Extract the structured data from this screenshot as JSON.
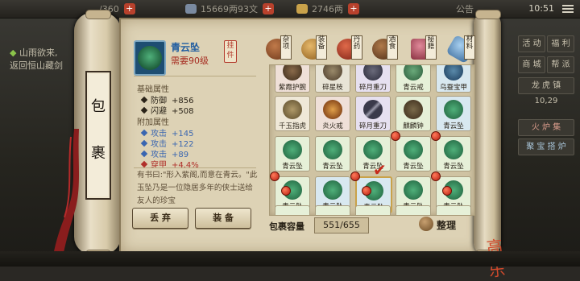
{
  "topbar": {
    "energy": "…/360",
    "silver": "15669两93文",
    "gold": "2746两",
    "notice": "公告",
    "time": "10:51"
  },
  "quest": {
    "line1": "山雨欲来,",
    "line2": "返回恒山藏剑"
  },
  "right_panel": {
    "btn_activity": "活 动",
    "btn_welfare": "福 利",
    "btn_mall": "商 城",
    "btn_gang": "帮 派",
    "btn_dragon": "龙 虎 镇",
    "coord": "10,29",
    "btn_furnace": "火 炉 集",
    "btn_treasure": "聚 宝 搭 炉"
  },
  "bag": {
    "title_1": "包",
    "title_2": "裹"
  },
  "detail": {
    "name": "青云坠",
    "requirement": "需要90级",
    "tag": "挂件",
    "base_title": "基础属性",
    "base_attrs": [
      {
        "label": "防御",
        "value": "+856"
      },
      {
        "label": "闪避",
        "value": "+508"
      }
    ],
    "extra_title": "附加属性",
    "extra_attrs": [
      {
        "label": "攻击",
        "value": "+145",
        "color": "#3a66b0"
      },
      {
        "label": "攻击",
        "value": "+122",
        "color": "#3a66b0"
      },
      {
        "label": "攻击",
        "value": "+89",
        "color": "#3a66b0"
      },
      {
        "label": "穿甲",
        "value": "+4.4%",
        "color": "#b0302a"
      }
    ],
    "description": "有书曰:\"形入紫阁,而意在青云。\"此玉坠乃是一位隐居多年的侠士送给友人的珍宝",
    "btn_discard": "丢 弃",
    "btn_equip": "装 备"
  },
  "categories": [
    {
      "label": "杂项",
      "color": "#8a4a2a"
    },
    {
      "label": "装备",
      "color": "#c98a3a"
    },
    {
      "label": "丹药",
      "color": "#b13a2a"
    },
    {
      "label": "酒食",
      "color": "#7a4a2a"
    },
    {
      "label": "秘籍",
      "color": "#b04050"
    },
    {
      "label": "材料",
      "color": "#5a8ac0"
    }
  ],
  "grid": {
    "row1": [
      "紫霞护腕",
      "碎星枝",
      "碎月重刀",
      "青云戒",
      "乌蚕宝甲"
    ],
    "row2": [
      "千玉指虎",
      "炎火戒",
      "碎月重刀",
      "麒麟钟",
      "青云坠"
    ],
    "row3": [
      "青云坠",
      "青云坠",
      "青云坠",
      "青云坠",
      "青云坠"
    ],
    "row4": [
      "青云坠",
      "青云坠",
      "青云坠",
      "青云坠",
      "青云坠"
    ]
  },
  "capacity": {
    "label": "包裹容量",
    "value": "551/655"
  },
  "tidy_label": "整理",
  "seal_text": "高乐"
}
